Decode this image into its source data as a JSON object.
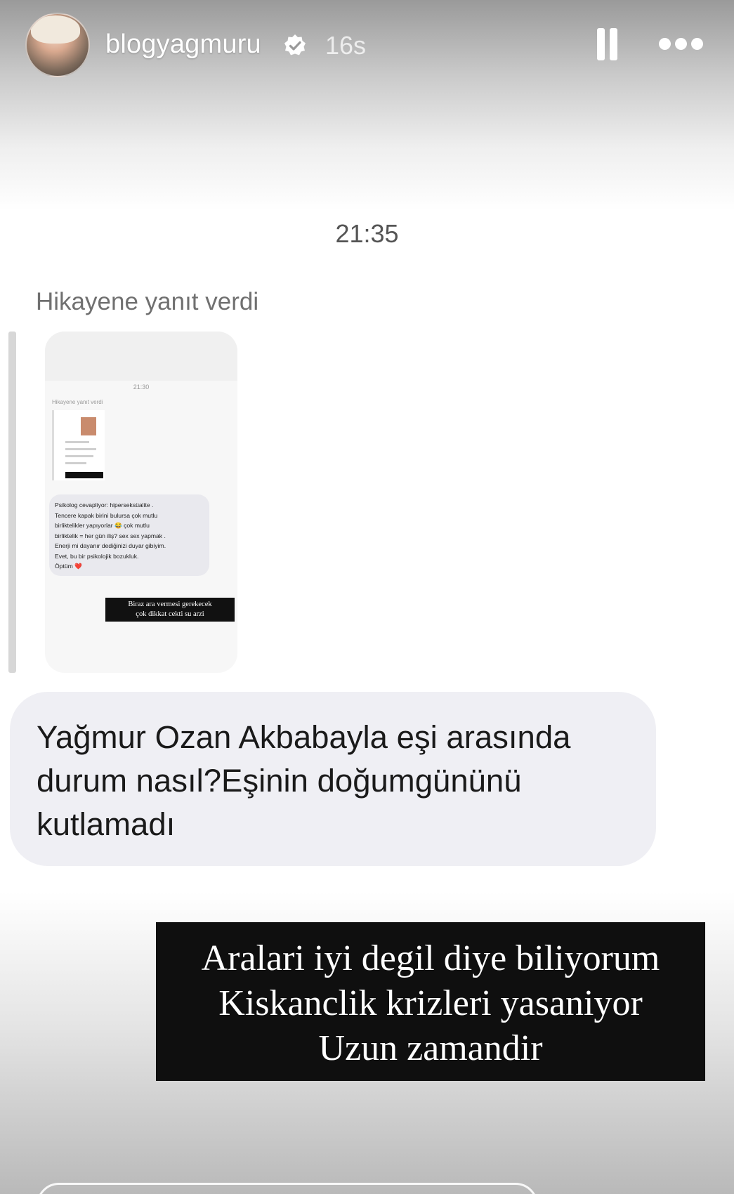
{
  "header": {
    "username": "blogyagmuru",
    "time_ago": "16s",
    "verified_icon": "verified-badge-icon",
    "pause_icon": "pause-icon",
    "more_icon": "more-options-icon"
  },
  "chat": {
    "timestamp": "21:35",
    "reply_label": "Hikayene yanıt verdi",
    "thumbnail": {
      "time": "21:30",
      "label": "Hikayene yanıt verdi",
      "message_lines": [
        "Psikolog cevapliyor: hiperseksüalite .",
        "Tencere kapak birini bulursa çok mutlu",
        "birliktelikler yapıyorlar 😂 çok mutlu",
        "birliktelik = her gün iliş? sex sex yapmak .",
        "Enerji mi dayanır dediğinizi duyar gibiyim.",
        "Evet, bu bir psikolojik bozukluk.",
        "Öptüm ❤️"
      ],
      "caption_lines": [
        "Biraz ara vermesi gerekecek",
        "çok dikkat cekti su arzi"
      ]
    },
    "message_lines": [
      "Yağmur Ozan Akbabayla eşi arasında",
      "durum nasıl?Eşinin doğumgününü",
      "kutlamadı"
    ],
    "caption_lines": [
      "Aralari iyi degil diye biliyorum",
      "Kiskanclik krizleri yasaniyor",
      "Uzun zamandir"
    ]
  },
  "colors": {
    "bubble": "#efeff4",
    "caption_bg": "#0f0f0f",
    "timestamp_text": "#555555"
  }
}
